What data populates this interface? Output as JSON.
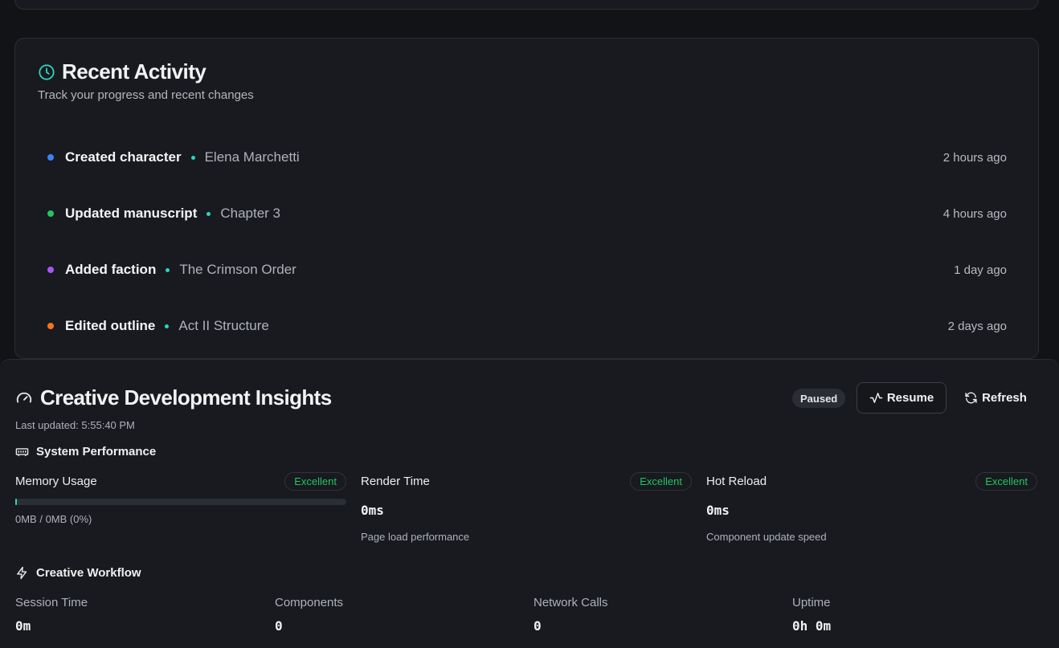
{
  "recent_activity": {
    "title": "Recent Activity",
    "subtitle": "Track your progress and recent changes",
    "items": [
      {
        "action": "Created character",
        "target": "Elena Marchetti",
        "time": "2 hours ago",
        "color": "#3b82f6"
      },
      {
        "action": "Updated manuscript",
        "target": "Chapter 3",
        "time": "4 hours ago",
        "color": "#22c55e"
      },
      {
        "action": "Added faction",
        "target": "The Crimson Order",
        "time": "1 day ago",
        "color": "#a855f7"
      },
      {
        "action": "Edited outline",
        "target": "Act II Structure",
        "time": "2 days ago",
        "color": "#f97316"
      }
    ]
  },
  "insights": {
    "title": "Creative Development Insights",
    "last_updated": "Last updated: 5:55:40 PM",
    "status_badge": "Paused",
    "resume_label": "Resume",
    "refresh_label": "Refresh",
    "system_performance": {
      "heading": "System Performance",
      "memory": {
        "name": "Memory Usage",
        "badge": "Excellent",
        "detail": "0MB / 0MB (0%)",
        "usage_fraction": 0.0
      },
      "render": {
        "name": "Render Time",
        "badge": "Excellent",
        "value": "0ms",
        "desc": "Page load performance"
      },
      "hot_reload": {
        "name": "Hot Reload",
        "badge": "Excellent",
        "value": "0ms",
        "desc": "Component update speed"
      }
    },
    "creative_workflow": {
      "heading": "Creative Workflow",
      "items": [
        {
          "label": "Session Time",
          "value": "0m"
        },
        {
          "label": "Components",
          "value": "0"
        },
        {
          "label": "Network Calls",
          "value": "0"
        },
        {
          "label": "Uptime",
          "value": "0h 0m"
        }
      ]
    }
  },
  "colors": {
    "accent": "#2dd4bf",
    "excellent": "#22c55e"
  }
}
